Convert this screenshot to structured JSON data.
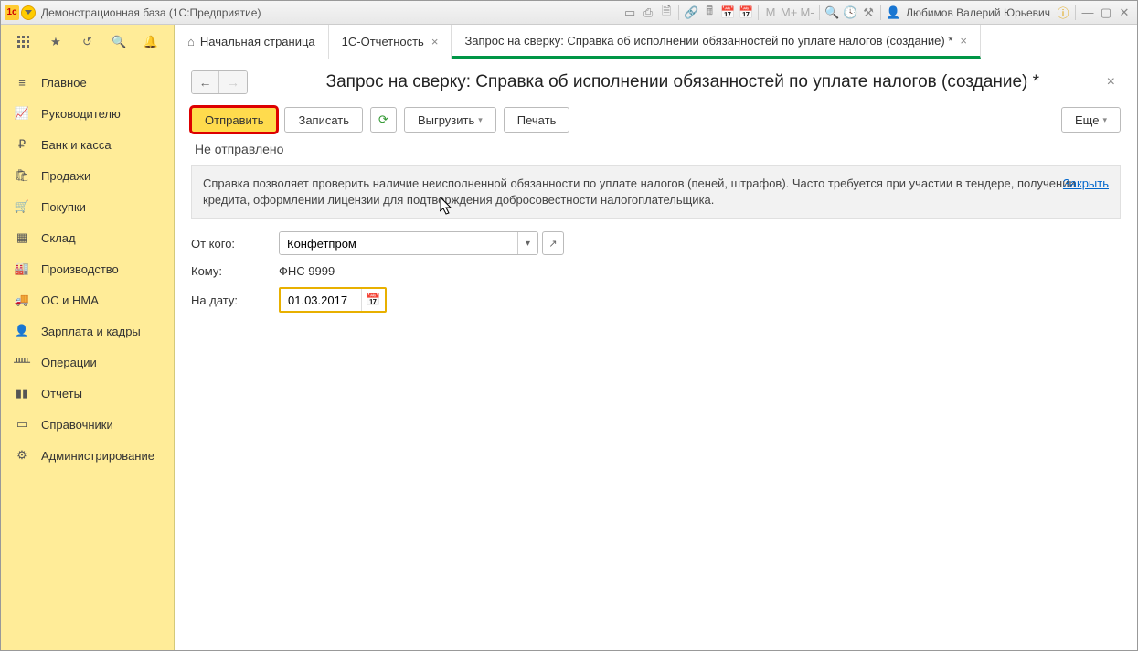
{
  "titlebar": {
    "title": "Демонстрационная база  (1С:Предприятие)",
    "user": "Любимов Валерий Юрьевич"
  },
  "tabs": {
    "home": "Начальная страница",
    "t1": "1С-Отчетность",
    "t2": "Запрос на сверку: Справка об исполнении обязанностей по уплате налогов (создание) *"
  },
  "sidebar": {
    "items": [
      {
        "label": "Главное"
      },
      {
        "label": "Руководителю"
      },
      {
        "label": "Банк и касса"
      },
      {
        "label": "Продажи"
      },
      {
        "label": "Покупки"
      },
      {
        "label": "Склад"
      },
      {
        "label": "Производство"
      },
      {
        "label": "ОС и НМА"
      },
      {
        "label": "Зарплата и кадры"
      },
      {
        "label": "Операции"
      },
      {
        "label": "Отчеты"
      },
      {
        "label": "Справочники"
      },
      {
        "label": "Администрирование"
      }
    ]
  },
  "page": {
    "title": "Запрос на сверку: Справка об исполнении обязанностей по уплате налогов (создание) *",
    "toolbar": {
      "send": "Отправить",
      "save": "Записать",
      "export": "Выгрузить",
      "print": "Печать",
      "more": "Еще"
    },
    "status": "Не отправлено",
    "info_text": "Справка позволяет проверить наличие неисполненной обязанности по уплате налогов (пеней, штрафов). Часто требуется при участии в тендере, получении кредита, оформлении лицензии для подтверждения добросовестности налогоплательщика.",
    "info_close": "Закрыть",
    "form": {
      "from_label": "От кого:",
      "from_value": "Конфетпром",
      "to_label": "Кому:",
      "to_value": "ФНС 9999",
      "date_label": "На дату:",
      "date_value": "01.03.2017"
    }
  }
}
